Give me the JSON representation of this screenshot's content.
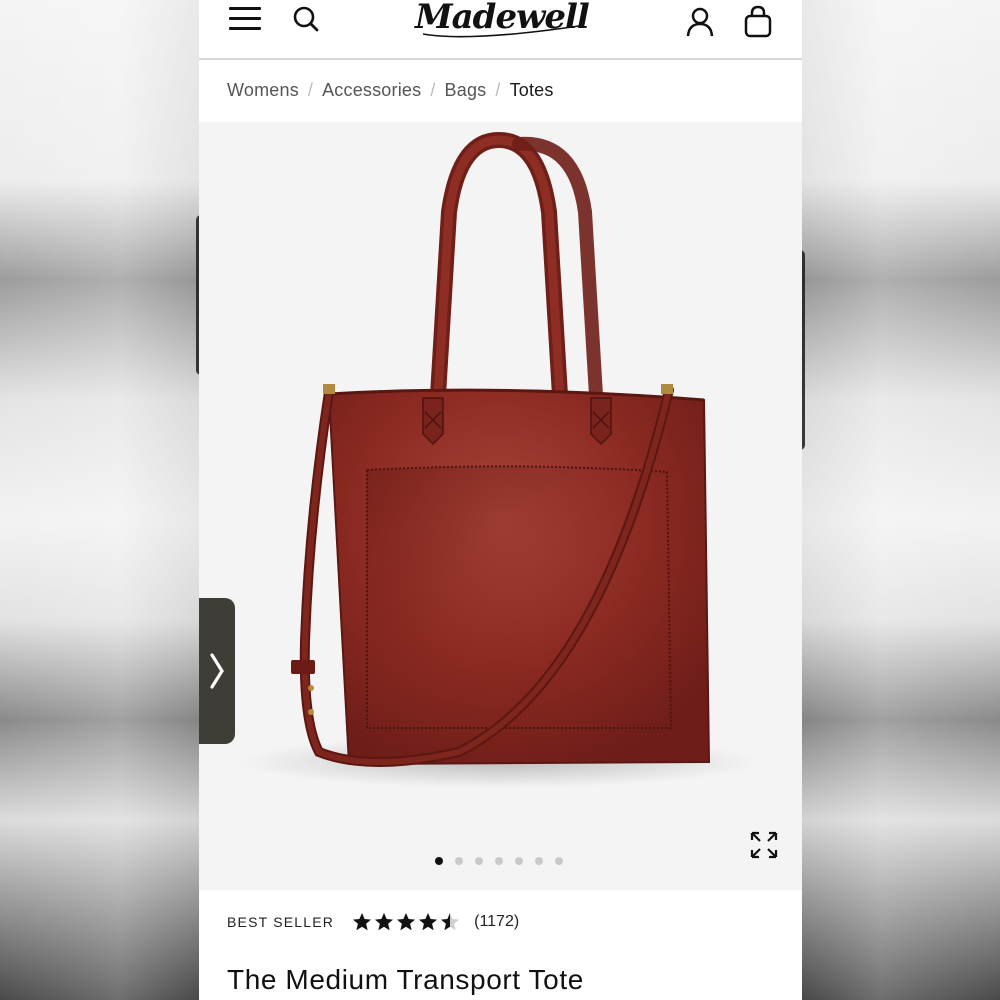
{
  "header": {
    "logo_text": "Madewell",
    "menu_icon": "hamburger-icon",
    "search_icon": "search-icon",
    "account_icon": "user-icon",
    "bag_icon": "shopping-bag-icon"
  },
  "breadcrumb": {
    "items": [
      "Womens",
      "Accessories",
      "Bags"
    ],
    "current": "Totes",
    "separator": "/"
  },
  "gallery": {
    "next_icon": "chevron-right-icon",
    "expand_icon": "expand-icon",
    "dot_count": 7,
    "active_dot": 1
  },
  "product": {
    "badge": "BEST SELLER",
    "rating": 4.5,
    "review_count": "(1172)",
    "title": "The Medium Transport Tote"
  },
  "colors": {
    "bag_leather": "#8b2a22",
    "text_primary": "#111111",
    "text_secondary": "#555555",
    "arrow_bg": "#3e3e36"
  }
}
